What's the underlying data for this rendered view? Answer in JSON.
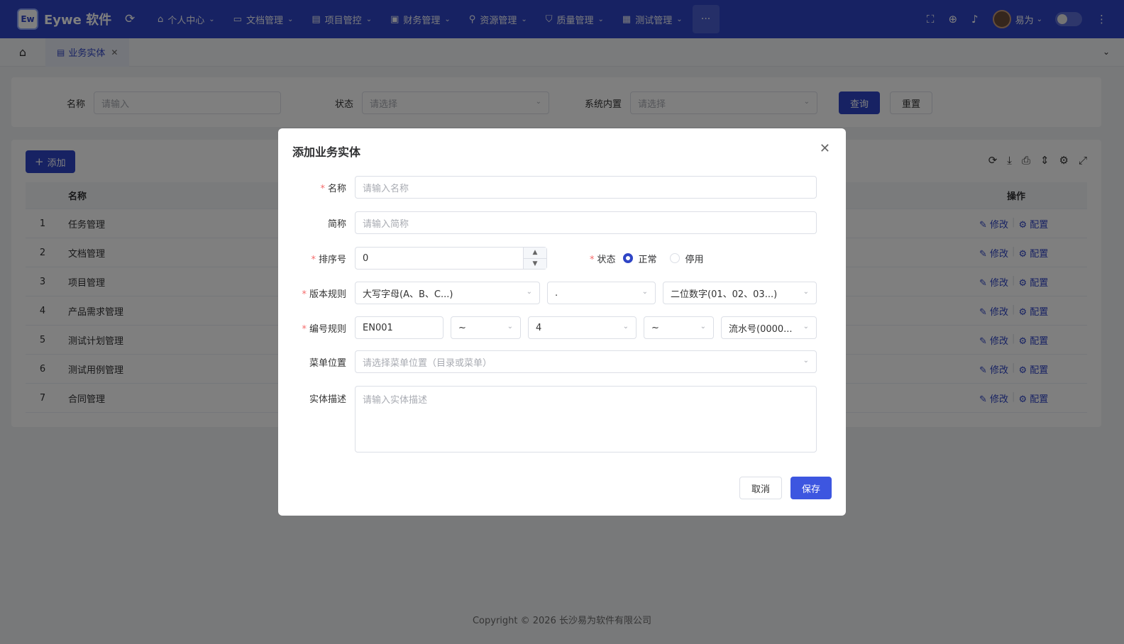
{
  "app": {
    "logo_abbr": "Ew",
    "name": "Eywe 软件"
  },
  "nav": [
    {
      "label": "个人中心",
      "icon": "home-icon"
    },
    {
      "label": "文档管理",
      "icon": "folder-icon"
    },
    {
      "label": "项目管控",
      "icon": "project-icon"
    },
    {
      "label": "财务管理",
      "icon": "finance-icon"
    },
    {
      "label": "资源管理",
      "icon": "resource-icon"
    },
    {
      "label": "质量管理",
      "icon": "shield-icon"
    },
    {
      "label": "测试管理",
      "icon": "calendar-icon"
    }
  ],
  "more_label": "···",
  "user": {
    "name": "易为"
  },
  "tabs": {
    "active": "业务实体"
  },
  "search": {
    "name_label": "名称",
    "name_placeholder": "请输入",
    "status_label": "状态",
    "status_placeholder": "请选择",
    "builtin_label": "系统内置",
    "builtin_placeholder": "请选择",
    "query": "查询",
    "reset": "重置"
  },
  "table": {
    "add_label": "添加",
    "headers": {
      "name": "名称",
      "ops": "操作"
    },
    "edit": "修改",
    "config": "配置",
    "rows": [
      {
        "idx": "1",
        "name": "任务管理"
      },
      {
        "idx": "2",
        "name": "文档管理"
      },
      {
        "idx": "3",
        "name": "项目管理"
      },
      {
        "idx": "4",
        "name": "产品需求管理"
      },
      {
        "idx": "5",
        "name": "测试计划管理"
      },
      {
        "idx": "6",
        "name": "测试用例管理"
      },
      {
        "idx": "7",
        "name": "合同管理"
      }
    ]
  },
  "dialog": {
    "title": "添加业务实体",
    "name_label": "名称",
    "name_placeholder": "请输入名称",
    "short_label": "简称",
    "short_placeholder": "请输入简称",
    "order_label": "排序号",
    "order_value": "0",
    "status_label": "状态",
    "status_on": "正常",
    "status_off": "停用",
    "version_label": "版本规则",
    "version_rule1": "大写字母(A、B、C...)",
    "version_sep": ".",
    "version_rule2": "二位数字(01、02、03...)",
    "code_label": "编号规则",
    "code_prefix": "EN001",
    "code_sep1": "~",
    "code_len": "4",
    "code_sep2": "~",
    "code_serial": "流水号(0000...",
    "menu_label": "菜单位置",
    "menu_placeholder": "请选择菜单位置（目录或菜单）",
    "desc_label": "实体描述",
    "desc_placeholder": "请输入实体描述",
    "cancel": "取消",
    "save": "保存"
  },
  "footer": "Copyright © 2026 长沙易为软件有限公司"
}
